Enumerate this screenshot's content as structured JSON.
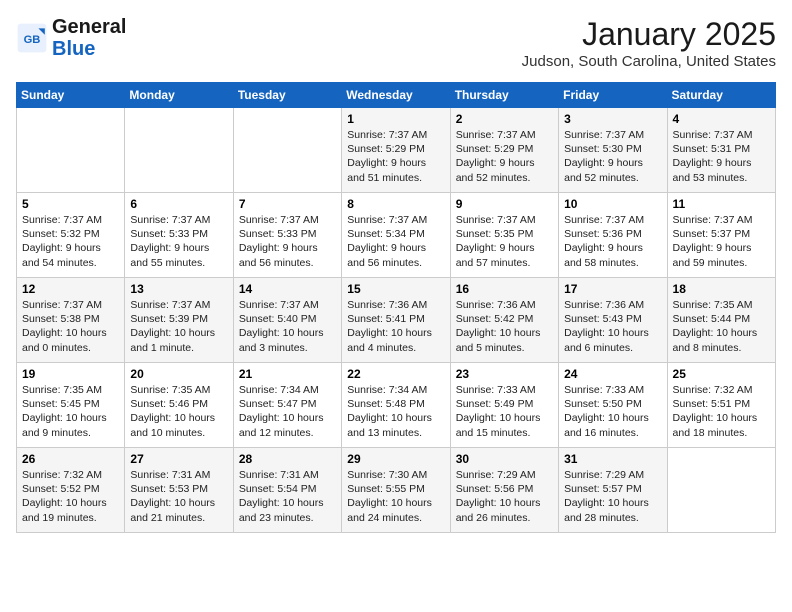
{
  "header": {
    "logo_line1": "General",
    "logo_line2": "Blue",
    "calendar_title": "January 2025",
    "calendar_subtitle": "Judson, South Carolina, United States"
  },
  "weekdays": [
    "Sunday",
    "Monday",
    "Tuesday",
    "Wednesday",
    "Thursday",
    "Friday",
    "Saturday"
  ],
  "weeks": [
    [
      {
        "day": "",
        "info": ""
      },
      {
        "day": "",
        "info": ""
      },
      {
        "day": "",
        "info": ""
      },
      {
        "day": "1",
        "info": "Sunrise: 7:37 AM\nSunset: 5:29 PM\nDaylight: 9 hours\nand 51 minutes."
      },
      {
        "day": "2",
        "info": "Sunrise: 7:37 AM\nSunset: 5:29 PM\nDaylight: 9 hours\nand 52 minutes."
      },
      {
        "day": "3",
        "info": "Sunrise: 7:37 AM\nSunset: 5:30 PM\nDaylight: 9 hours\nand 52 minutes."
      },
      {
        "day": "4",
        "info": "Sunrise: 7:37 AM\nSunset: 5:31 PM\nDaylight: 9 hours\nand 53 minutes."
      }
    ],
    [
      {
        "day": "5",
        "info": "Sunrise: 7:37 AM\nSunset: 5:32 PM\nDaylight: 9 hours\nand 54 minutes."
      },
      {
        "day": "6",
        "info": "Sunrise: 7:37 AM\nSunset: 5:33 PM\nDaylight: 9 hours\nand 55 minutes."
      },
      {
        "day": "7",
        "info": "Sunrise: 7:37 AM\nSunset: 5:33 PM\nDaylight: 9 hours\nand 56 minutes."
      },
      {
        "day": "8",
        "info": "Sunrise: 7:37 AM\nSunset: 5:34 PM\nDaylight: 9 hours\nand 56 minutes."
      },
      {
        "day": "9",
        "info": "Sunrise: 7:37 AM\nSunset: 5:35 PM\nDaylight: 9 hours\nand 57 minutes."
      },
      {
        "day": "10",
        "info": "Sunrise: 7:37 AM\nSunset: 5:36 PM\nDaylight: 9 hours\nand 58 minutes."
      },
      {
        "day": "11",
        "info": "Sunrise: 7:37 AM\nSunset: 5:37 PM\nDaylight: 9 hours\nand 59 minutes."
      }
    ],
    [
      {
        "day": "12",
        "info": "Sunrise: 7:37 AM\nSunset: 5:38 PM\nDaylight: 10 hours\nand 0 minutes."
      },
      {
        "day": "13",
        "info": "Sunrise: 7:37 AM\nSunset: 5:39 PM\nDaylight: 10 hours\nand 1 minute."
      },
      {
        "day": "14",
        "info": "Sunrise: 7:37 AM\nSunset: 5:40 PM\nDaylight: 10 hours\nand 3 minutes."
      },
      {
        "day": "15",
        "info": "Sunrise: 7:36 AM\nSunset: 5:41 PM\nDaylight: 10 hours\nand 4 minutes."
      },
      {
        "day": "16",
        "info": "Sunrise: 7:36 AM\nSunset: 5:42 PM\nDaylight: 10 hours\nand 5 minutes."
      },
      {
        "day": "17",
        "info": "Sunrise: 7:36 AM\nSunset: 5:43 PM\nDaylight: 10 hours\nand 6 minutes."
      },
      {
        "day": "18",
        "info": "Sunrise: 7:35 AM\nSunset: 5:44 PM\nDaylight: 10 hours\nand 8 minutes."
      }
    ],
    [
      {
        "day": "19",
        "info": "Sunrise: 7:35 AM\nSunset: 5:45 PM\nDaylight: 10 hours\nand 9 minutes."
      },
      {
        "day": "20",
        "info": "Sunrise: 7:35 AM\nSunset: 5:46 PM\nDaylight: 10 hours\nand 10 minutes."
      },
      {
        "day": "21",
        "info": "Sunrise: 7:34 AM\nSunset: 5:47 PM\nDaylight: 10 hours\nand 12 minutes."
      },
      {
        "day": "22",
        "info": "Sunrise: 7:34 AM\nSunset: 5:48 PM\nDaylight: 10 hours\nand 13 minutes."
      },
      {
        "day": "23",
        "info": "Sunrise: 7:33 AM\nSunset: 5:49 PM\nDaylight: 10 hours\nand 15 minutes."
      },
      {
        "day": "24",
        "info": "Sunrise: 7:33 AM\nSunset: 5:50 PM\nDaylight: 10 hours\nand 16 minutes."
      },
      {
        "day": "25",
        "info": "Sunrise: 7:32 AM\nSunset: 5:51 PM\nDaylight: 10 hours\nand 18 minutes."
      }
    ],
    [
      {
        "day": "26",
        "info": "Sunrise: 7:32 AM\nSunset: 5:52 PM\nDaylight: 10 hours\nand 19 minutes."
      },
      {
        "day": "27",
        "info": "Sunrise: 7:31 AM\nSunset: 5:53 PM\nDaylight: 10 hours\nand 21 minutes."
      },
      {
        "day": "28",
        "info": "Sunrise: 7:31 AM\nSunset: 5:54 PM\nDaylight: 10 hours\nand 23 minutes."
      },
      {
        "day": "29",
        "info": "Sunrise: 7:30 AM\nSunset: 5:55 PM\nDaylight: 10 hours\nand 24 minutes."
      },
      {
        "day": "30",
        "info": "Sunrise: 7:29 AM\nSunset: 5:56 PM\nDaylight: 10 hours\nand 26 minutes."
      },
      {
        "day": "31",
        "info": "Sunrise: 7:29 AM\nSunset: 5:57 PM\nDaylight: 10 hours\nand 28 minutes."
      },
      {
        "day": "",
        "info": ""
      }
    ]
  ]
}
